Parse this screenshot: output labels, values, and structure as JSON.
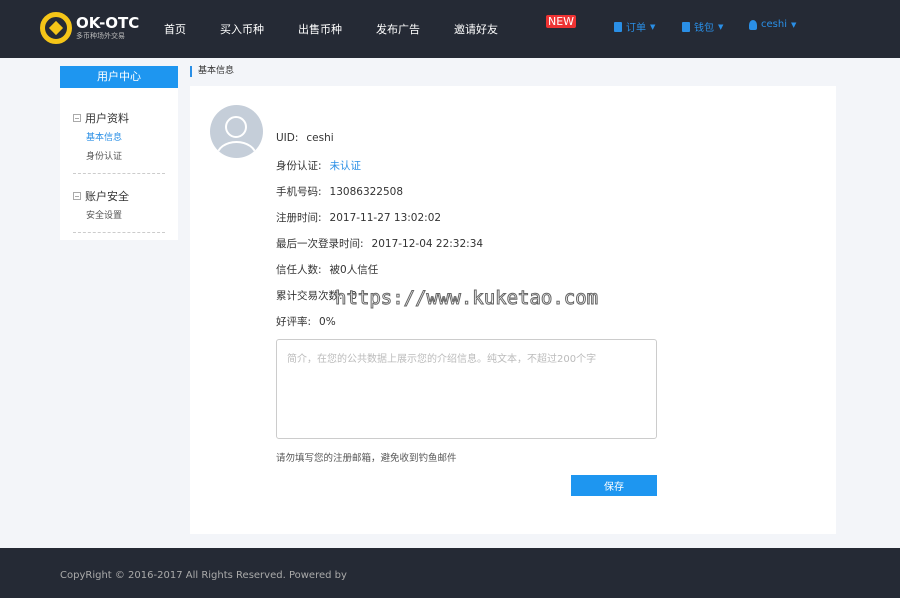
{
  "header": {
    "logo_title": "OK-OTC",
    "logo_subtitle": "多币种场外交易",
    "nav": [
      "首页",
      "买入币种",
      "出售币种",
      "发布广告",
      "邀请好友"
    ],
    "new_badge": "NEW",
    "orders": "订单",
    "wallet": "钱包",
    "user": "ceshi"
  },
  "sidebar": {
    "title": "用户中心",
    "groups": [
      {
        "label": "用户资料",
        "items": [
          "基本信息",
          "身份认证"
        ]
      },
      {
        "label": "账户安全",
        "items": [
          "安全设置"
        ]
      }
    ]
  },
  "breadcrumb": "基本信息",
  "profile": {
    "rows": [
      {
        "label": "UID:",
        "value": "ceshi"
      },
      {
        "label": "身份认证:",
        "value": "未认证"
      },
      {
        "label": "手机号码:",
        "value": "13086322508"
      },
      {
        "label": "注册时间:",
        "value": "2017-11-27 13:02:02"
      },
      {
        "label": "最后一次登录时间:",
        "value": "2017-12-04 22:32:34"
      },
      {
        "label": "信任人数:",
        "value": "被0人信任"
      },
      {
        "label": "累计交易次数:",
        "value": "0"
      },
      {
        "label": "好评率:",
        "value": "0%"
      }
    ],
    "bio_placeholder": "简介，在您的公共数据上展示您的介绍信息。纯文本，不超过200个字",
    "hint": "请勿填写您的注册邮箱，避免收到钓鱼邮件",
    "save": "保存"
  },
  "watermark": "https://www.kuketao.com",
  "footer": "CopyRight © 2016-2017 All Rights Reserved. Powered by"
}
